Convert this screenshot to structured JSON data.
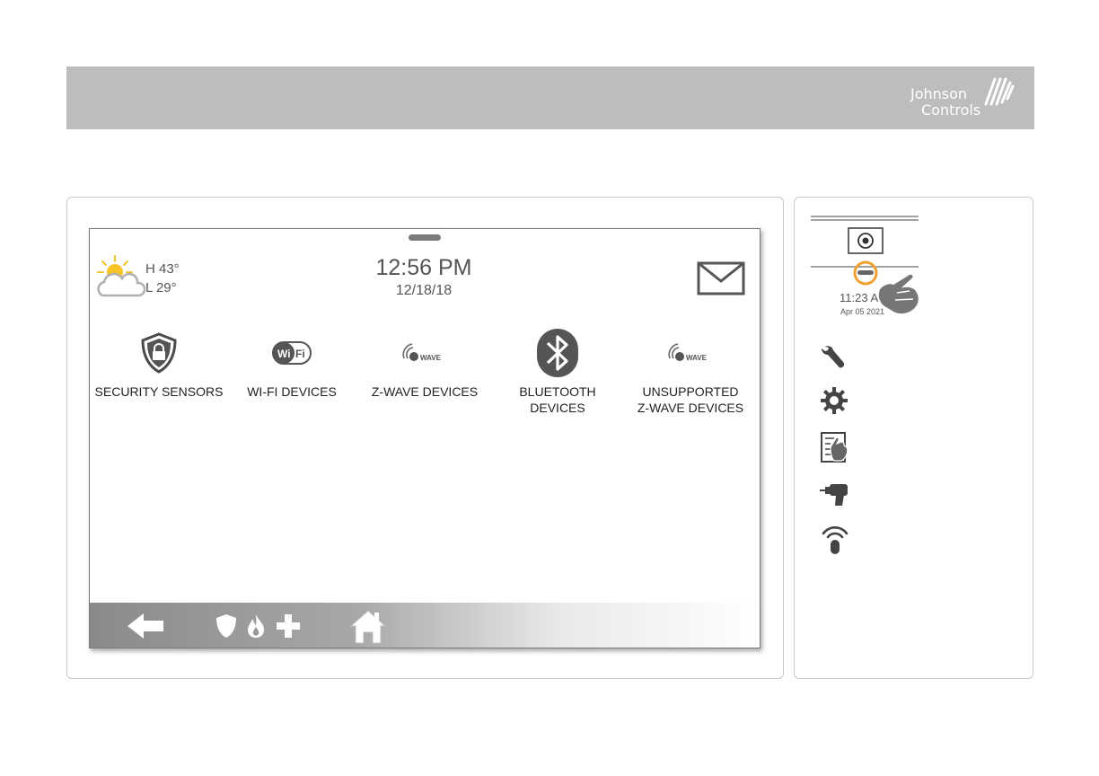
{
  "brand": {
    "line1": "Johnson",
    "line2": "Controls"
  },
  "panel": {
    "weather": {
      "high": "H 43°",
      "low": "L 29°",
      "icon": "partly-cloudy-icon"
    },
    "clock": {
      "time": "12:56 PM",
      "date": "12/18/18"
    },
    "message_icon": "envelope-icon",
    "tiles": [
      {
        "label": "SECURITY SENSORS",
        "icon": "shield-lock-icon"
      },
      {
        "label": "WI-FI DEVICES",
        "icon": "wifi-icon"
      },
      {
        "label": "Z-WAVE DEVICES",
        "icon": "zwave-icon",
        "badge": "WAVE"
      },
      {
        "label_line1": "BLUETOOTH",
        "label_line2": "DEVICES",
        "icon": "bluetooth-icon"
      },
      {
        "label_line1": "UNSUPPORTED",
        "label_line2": "Z-WAVE DEVICES",
        "icon": "zwave-icon",
        "badge": "WAVE"
      }
    ],
    "navbar": [
      "back-arrow-icon",
      "shield-icon",
      "fire-icon",
      "medical-cross-icon",
      "home-icon"
    ]
  },
  "sidebar": {
    "mini_time": "11:23 AM",
    "mini_date": "Apr 05 2021",
    "icons": [
      "wrench-icon",
      "gear-icon",
      "touchscreen-hand-icon",
      "drill-icon",
      "remote-signal-icon"
    ]
  }
}
